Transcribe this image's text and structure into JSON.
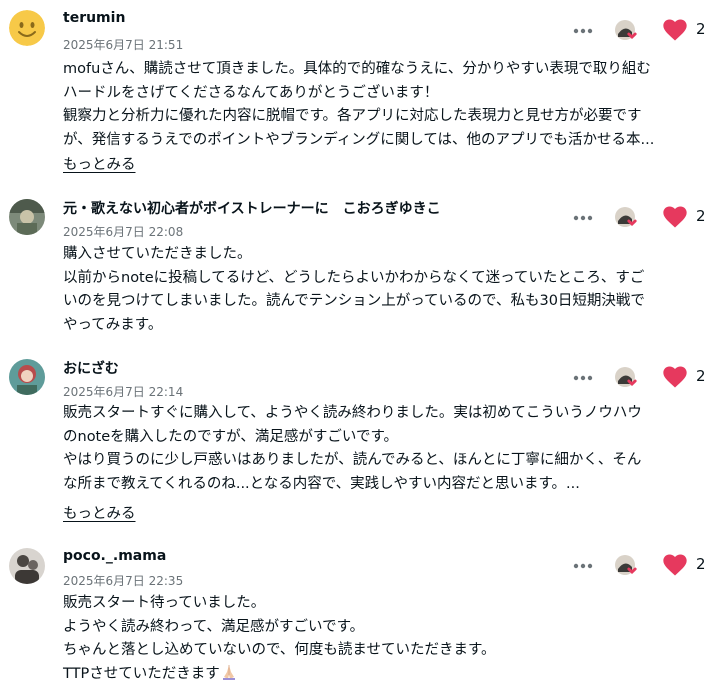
{
  "colors": {
    "heart": "#e6395e",
    "text": "#08131a",
    "muted": "#6b7378"
  },
  "comments": [
    {
      "author": "terumin",
      "date": "2025年6月7日 21:51",
      "avatar": "smiley-avatar-icon",
      "lines": [
        "mofuさん、購読させて頂きました。具体的で的確なうえに、分かりやすい表現で取り組む",
        "ハードルをさげてくださるなんてありがとうございます！",
        "観察力と分析力に優れた内容に脱帽です。各アプリに対応した表現力と見せ方が必要です",
        "が、発信するうえでのポイントやブランディングに関しては、他のアプリでも活かせる本..."
      ],
      "more_label": "もっとみる",
      "like_count": "2"
    },
    {
      "author": "元・歌えない初心者がボイストレーナーに　こおろぎゆきこ",
      "date": "2025年6月7日 22:08",
      "avatar": "user-photo-avatar",
      "lines": [
        "購入させていただきました。",
        "以前からnoteに投稿してるけど、どうしたらよいかわからなくて迷っていたところ、すご",
        "いのを見つけてしまいました。読んでテンション上がっているので、私も30日短期決戦で",
        "やってみます。"
      ],
      "like_count": "2"
    },
    {
      "author": "おにざむ",
      "date": "2025年6月7日 22:14",
      "avatar": "user-photo-avatar",
      "lines": [
        "販売スタートすぐに購入して、ようやく読み終わりました。実は初めてこういうノウハウ",
        "のnoteを購入したのですが、満足感がすごいです。",
        "やはり買うのに少し戸惑いはありましたが、読んでみると、ほんとに丁寧に細かく、そん",
        "な所まで教えてくれるのね...となる内容で、実践しやすい内容だと思います。..."
      ],
      "more_label": "もっとみる",
      "like_count": "2"
    },
    {
      "author": "poco._.mama",
      "date": "2025年6月7日 22:35",
      "avatar": "user-photo-avatar",
      "lines": [
        "販売スタート待っていました。",
        "ようやく読み終わって、満足感がすごいです。",
        "ちゃんと落とし込めていないので、何度も読ませていただきます。",
        "TTPさせていただきます"
      ],
      "trailing_icon": "praying-hands-icon",
      "like_count": "2"
    }
  ]
}
